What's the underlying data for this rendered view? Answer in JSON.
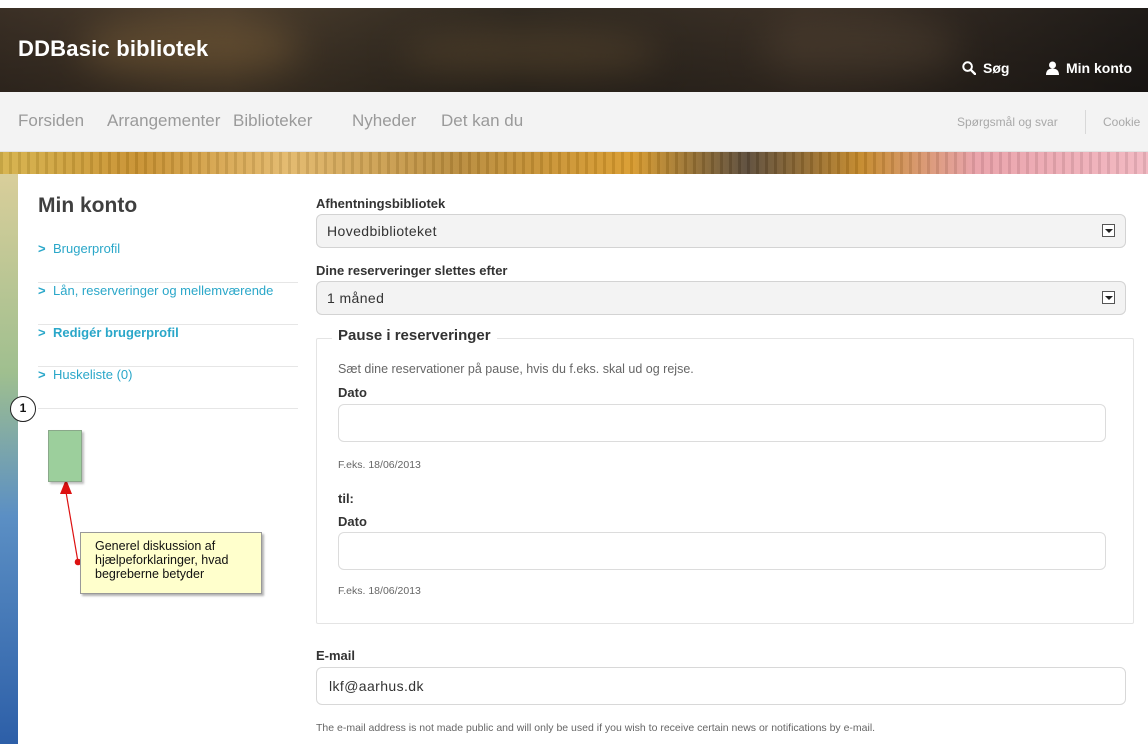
{
  "header": {
    "site_title": "DDBasic bibliotek",
    "search_label": "Søg",
    "account_label": "Min konto"
  },
  "nav": {
    "main": [
      "Forsiden",
      "Arrangementer",
      "Biblioteker",
      "Nyheder",
      "Det kan du"
    ],
    "secondary": [
      "Spørgsmål og svar",
      "Cookie"
    ]
  },
  "sidebar": {
    "title": "Min konto",
    "items": [
      {
        "label": "Brugerprofil"
      },
      {
        "label": "Lån, reserveringer og mellemværende"
      },
      {
        "label": "Redigér brugerprofil"
      },
      {
        "label": "Huskeliste (0)"
      }
    ]
  },
  "form": {
    "pickup_label": "Afhentningsbibliotek",
    "pickup_value": "Hovedbiblioteket",
    "delete_label": "Dine reserveringer slettes efter",
    "delete_value": "1 måned",
    "pause": {
      "legend": "Pause i reserveringer",
      "description": "Sæt dine reservationer på pause, hvis du f.eks. skal ud og rejse.",
      "from_label": "Dato",
      "from_value": "",
      "from_help": "F.eks. 18/06/2013",
      "til_label": "til:",
      "to_label": "Dato",
      "to_value": "",
      "to_help": "F.eks. 18/06/2013"
    },
    "email_label": "E-mail",
    "email_value": "lkf@aarhus.dk",
    "email_help": "The e-mail address is not made public and will only be used if you wish to receive certain news or notifications by e-mail."
  },
  "annotation": {
    "number": "1",
    "note": "Generel diskussion af\nhjælpeforklaringer, hvad\nbegreberne betyder",
    "colors": {
      "box": "#9ccf9c",
      "note_bg": "#ffffcc",
      "arrow": "#dd1111"
    }
  },
  "colors": {
    "link": "#2aa7c9",
    "nav_text": "#9a9a9a"
  },
  "icons": [
    "search-icon",
    "user-icon",
    "chevron-right-icon",
    "dropdown-arrow-icon"
  ]
}
